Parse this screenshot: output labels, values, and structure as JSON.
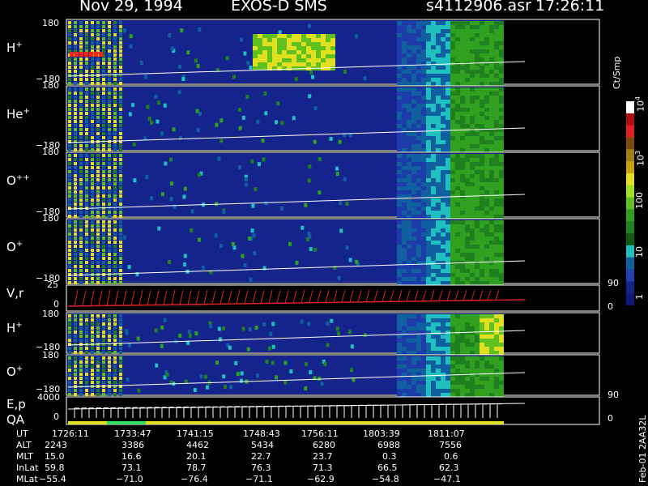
{
  "header": {
    "date": "Nov 29, 1994",
    "instrument": "EXOS-D SMS",
    "file": "s4112906.asr",
    "time": "17:26:11"
  },
  "colors": {
    "background": "#000000",
    "spectrogram_low": "#14248c",
    "spectrogram_high": "#ff2010",
    "trace_line": "#ffffff",
    "velocity_trace": "#e02020",
    "energy_band": "#e0e020",
    "energy_band_alt": "#30e060"
  },
  "chart_data": {
    "type": "heatmap",
    "panels": [
      {
        "label": "H",
        "sup": "+",
        "ylim_top": "180",
        "ylim_bottom": "−180"
      },
      {
        "label": "He",
        "sup": "+",
        "ylim_top": "180",
        "ylim_bottom": "−180"
      },
      {
        "label": "O",
        "sup": "++",
        "ylim_top": "180",
        "ylim_bottom": "−180"
      },
      {
        "label": "O",
        "sup": "+",
        "ylim_top": "180",
        "ylim_bottom": "−180"
      },
      {
        "label": "V,r",
        "sup": "",
        "ylim_top": "25",
        "ylim_bottom": "0",
        "right_top": "90",
        "right_bottom": "0"
      },
      {
        "label": "H",
        "sup": "+",
        "ylim_top": "180",
        "ylim_bottom": "−180"
      },
      {
        "label": "O",
        "sup": "+",
        "ylim_top": "180",
        "ylim_bottom": "−180"
      },
      {
        "label": "E,p",
        "label2": "QA",
        "sup": "",
        "ylim_top": "4000",
        "ylim_bottom": "0",
        "right_top": "90",
        "right_bottom": "0"
      }
    ],
    "colorbar": {
      "unit": "Ct/Smp",
      "ticks": [
        "10",
        "10",
        "100",
        "10",
        "1"
      ],
      "tick_exps": [
        "4",
        "3",
        "",
        "",
        ""
      ],
      "colors": [
        "#ffffff",
        "#b01010",
        "#e02020",
        "#7a4a10",
        "#a08010",
        "#c8a010",
        "#e0e020",
        "#a0e020",
        "#60c020",
        "#30a020",
        "#208020",
        "#105a10",
        "#20c0c0",
        "#1060a0",
        "#2040b0",
        "#14248c",
        "#101878"
      ]
    },
    "side_label": "Feb-01 2AA32L",
    "xaxis_rows": [
      {
        "name": "UT",
        "values": [
          "1726:11",
          "1733:47",
          "1741:15",
          "1748:43",
          "1756:11",
          "1803:39",
          "1811:07"
        ]
      },
      {
        "name": "ALT",
        "values": [
          "2243",
          "3386",
          "4462",
          "5434",
          "6280",
          "6988",
          "7556"
        ]
      },
      {
        "name": "MLT",
        "values": [
          "15.0",
          "16.6",
          "20.1",
          "22.7",
          "23.7",
          "0.3",
          "0.6"
        ]
      },
      {
        "name": "InLat",
        "values": [
          "59.8",
          "73.1",
          "78.7",
          "76.3",
          "71.3",
          "66.5",
          "62.3"
        ]
      },
      {
        "name": "MLat",
        "values": [
          "−55.4",
          "−71.0",
          "−76.4",
          "−71.1",
          "−62.9",
          "−54.8",
          "−47.1"
        ]
      }
    ]
  }
}
